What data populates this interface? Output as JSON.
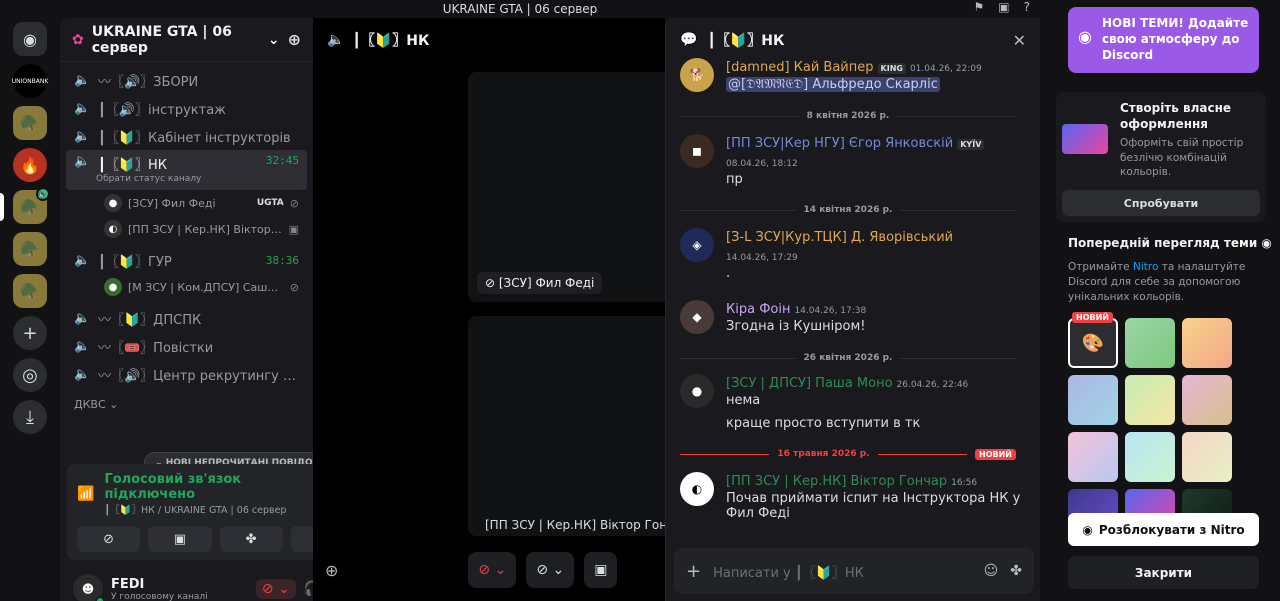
{
  "titlebar": {
    "title": "UKRAINE GTA | 06 сервер",
    "icons": [
      "pin-icon",
      "inbox-icon",
      "help-icon"
    ]
  },
  "rail": {
    "servers": [
      "home",
      "ukraine-gta-1",
      "ukraine-gta-2",
      "fire-server",
      "ukraine-gta-active",
      "ukraine-gta-voice-1",
      "ukraine-gta-voice-2"
    ],
    "home_icon": "discord-icon",
    "s1_text": "UNIONBANK"
  },
  "guild": {
    "name": "UKRAINE GTA | 06 сервер"
  },
  "channels": [
    {
      "name": "〰〖🔊〗ЗБОРИ"
    },
    {
      "name": "┃〖🔊〗інструктаж"
    },
    {
      "name": "┃〖🔰〗Кабінет інструкторів"
    },
    {
      "name": "┃〖🔰〗НК",
      "timer": "32:45",
      "status": "Обрати статус каналу"
    },
    {
      "name": "┃〖🔰〗ГУР",
      "timer": "38:36"
    },
    {
      "name": "〰〖🔰〗ДПСПК"
    },
    {
      "name": "〰〖🎟️〗Повістки"
    },
    {
      "name": "〰〖🔊〗Центр рекрутингу та п..."
    }
  ],
  "voice_users_nk": [
    {
      "name": "[ЗСУ] Фил Феді",
      "tag": "UGTA"
    },
    {
      "name": "[ПП ЗСУ | Кер.НК] Віктор Го..."
    }
  ],
  "voice_users_gur": [
    {
      "name": "[М ЗСУ | Ком.ДПСУ] Саша К..."
    }
  ],
  "category": "ДКВС",
  "unread_pill": "НОВІ НЕПРОЧИТАНІ ПОВІДОМЛЕННЯ",
  "voice_panel": {
    "title": "Голосовий зв'язок підключено",
    "sub": "┃〖🔰〗НК / UKRAINE GTA | 06 сервер"
  },
  "user": {
    "name": "FEDI",
    "status": "У голосовому каналі"
  },
  "stage": {
    "header": "┃〖🔰〗НК",
    "tile_label": "[ЗСУ] Фил Феді",
    "tile_name": "[ПП ЗСУ | Кер.НК] Віктор Гончар"
  },
  "chat": {
    "header": "┃〖🔰〗НК",
    "messages": [
      {
        "author": "[damned] Кай Вайпер",
        "author_color": "#e0a84f",
        "tag": "KING",
        "time": "01.04.26, 22:09",
        "mention": "@[𝔇𝔄𝔐𝔑𝔈𝔇] Альфредо Скарліс"
      },
      {
        "divider": "8 квітня 2026 р."
      },
      {
        "author": "[ПП ЗСУ|Кер НГУ] Єгор Янковскій",
        "author_color": "#7289da",
        "tag": "KYÏV",
        "time": "08.04.26, 18:12",
        "text": "пр"
      },
      {
        "divider": "14 квітня 2026 р."
      },
      {
        "author": "[З-L ЗСУ|Кур.ТЦК] Д. Яворівський",
        "author_color": "#e0a84f",
        "time": "14.04.26, 17:29",
        "text": "."
      },
      {
        "author": "Кіра Фоін",
        "author_color": "#c9a3f5",
        "time": "14.04.26, 17:38",
        "text": "Згодна із Кушніром!"
      },
      {
        "divider": "26 квітня 2026 р."
      },
      {
        "author": "[ЗСУ | ДПСУ] Паша Моно",
        "author_color": "#2e8b57",
        "time": "26.04.26, 22:46",
        "text": "нема",
        "text2": "краще просто вступити в тк"
      },
      {
        "divider": "16 травня 2026 р.",
        "new": "НОВИЙ"
      },
      {
        "author": "[ПП ЗСУ | Кер.НК] Віктор Гончар",
        "author_color": "#2e8b57",
        "time": "16:56",
        "text": "Почав приймати іспит на Інструктора НК у Фил Феді"
      }
    ],
    "composer_placeholder": "Написати у ┃〖🔰〗НК"
  },
  "nitro": {
    "banner": "НОВІ ТЕМИ! Додайте свою атмосферу до Discord",
    "card_title": "Створіть власне оформлення",
    "card_desc": "Оформіть свій простір безлічю комбінацій кольорів.",
    "try": "Спробувати",
    "preview_title": "Попередній перегляд теми",
    "preview_desc_pre": "Отримайте ",
    "preview_desc_link": "Nitro",
    "preview_desc_post": " та налаштуйте Discord для себе за допомогою унікальних кольорів.",
    "new_tag": "НОВИЙ",
    "unlock": "Розблокувати з Nitro",
    "close": "Закрити",
    "themes": [
      "#2b2d31",
      "linear-gradient(135deg,#9bd6a5,#7ec87f)",
      "linear-gradient(135deg,#f8d28a,#f3a78a)",
      "linear-gradient(135deg,#aeb6e6,#9ed4e3)",
      "linear-gradient(135deg,#c6ecb3,#f5e6a3)",
      "linear-gradient(135deg,#e7b6d6,#d6c08c)",
      "linear-gradient(135deg,#f5c2d9,#b9c8f1)",
      "linear-gradient(135deg,#b7e6f5,#c9f3d1)",
      "linear-gradient(135deg,#f5d6c5,#e8f0c4)",
      "linear-gradient(135deg,#3d3a8a,#6a4bd1)",
      "linear-gradient(135deg,#5865f2,#eb459e)",
      "linear-gradient(135deg,#1e3a2a,#0e1a14)"
    ]
  }
}
